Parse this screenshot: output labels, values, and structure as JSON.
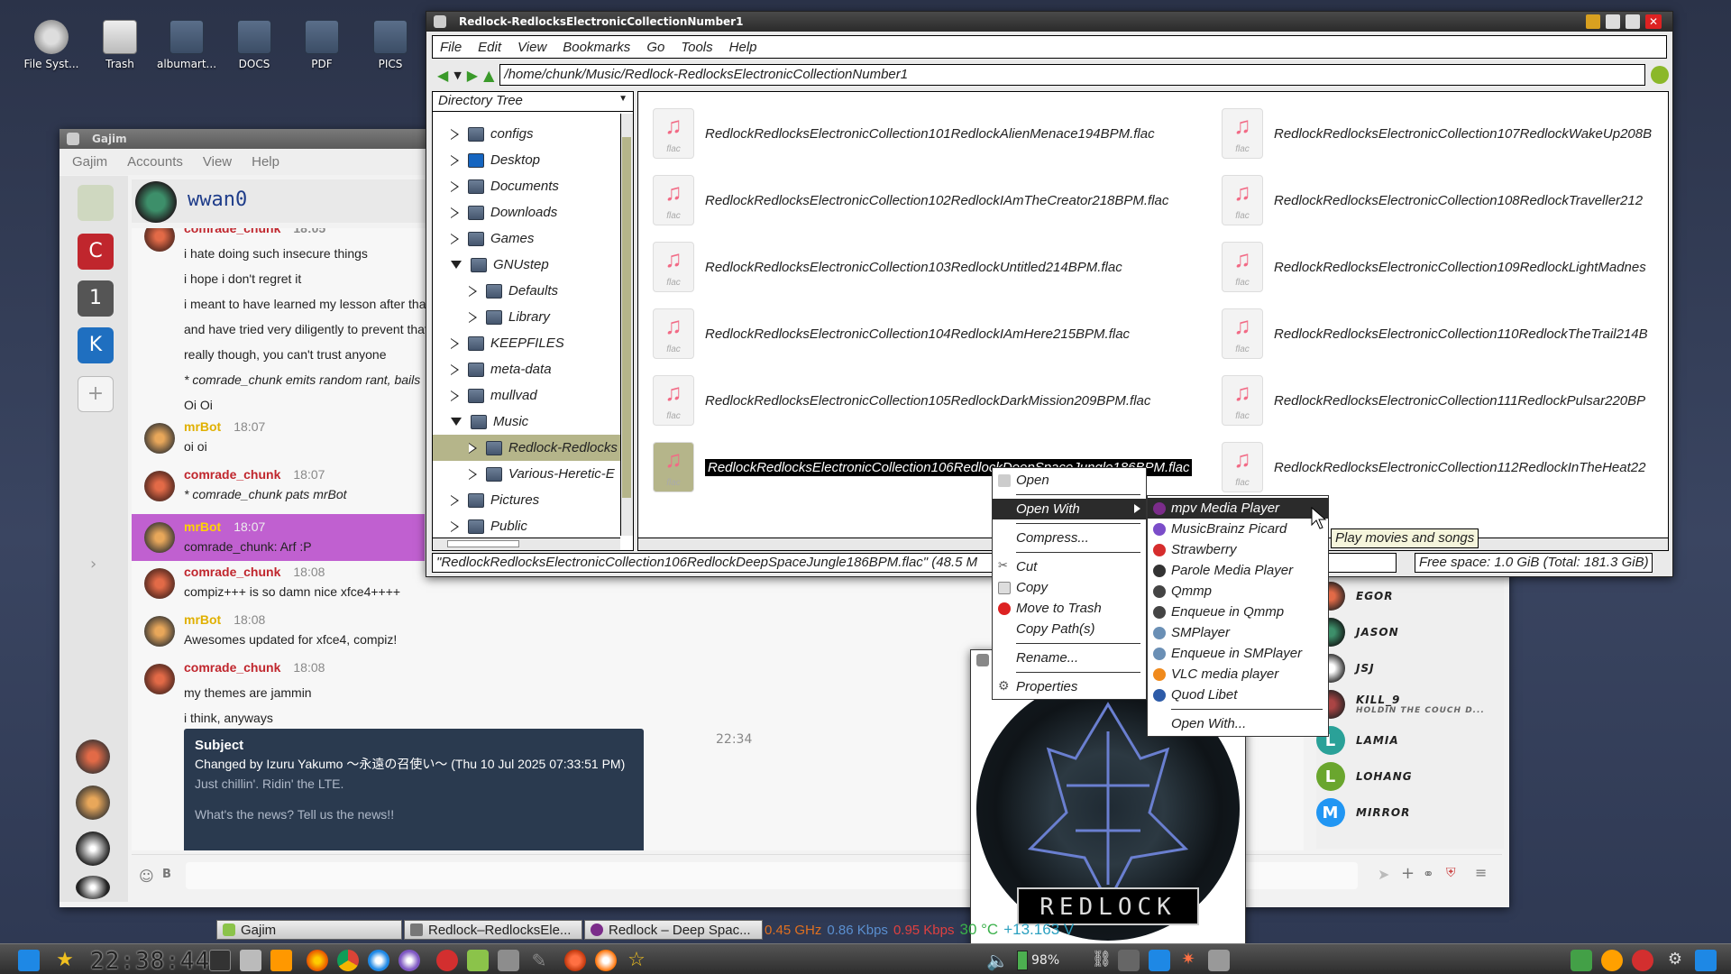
{
  "desktop": {
    "icons": [
      {
        "label": "File Syst..."
      },
      {
        "label": "Trash"
      },
      {
        "label": "albumart..."
      },
      {
        "label": "DOCS"
      },
      {
        "label": "PDF"
      },
      {
        "label": "PICS"
      }
    ]
  },
  "fm": {
    "title": "Redlock-RedlocksElectronicCollectionNumber1",
    "menu": [
      "File",
      "Edit",
      "View",
      "Bookmarks",
      "Go",
      "Tools",
      "Help"
    ],
    "location": "/home/chunk/Music/Redlock-RedlocksElectronicCollectionNumber1",
    "tree_header": "Directory Tree",
    "tree": [
      {
        "label": "configs",
        "level": 0,
        "state": "closed",
        "icon": "folder-icon"
      },
      {
        "label": "Desktop",
        "level": 0,
        "state": "closed",
        "icon": "desktop-folder-icon"
      },
      {
        "label": "Documents",
        "level": 0,
        "state": "closed",
        "icon": "folder-icon"
      },
      {
        "label": "Downloads",
        "level": 0,
        "state": "closed",
        "icon": "folder-icon"
      },
      {
        "label": "Games",
        "level": 0,
        "state": "closed",
        "icon": "folder-icon"
      },
      {
        "label": "GNUstep",
        "level": 0,
        "state": "open",
        "icon": "folder-icon"
      },
      {
        "label": "Defaults",
        "level": 1,
        "state": "closed",
        "icon": "folder-icon"
      },
      {
        "label": "Library",
        "level": 1,
        "state": "closed",
        "icon": "folder-icon"
      },
      {
        "label": "KEEPFILES",
        "level": 0,
        "state": "closed",
        "icon": "folder-icon"
      },
      {
        "label": "meta-data",
        "level": 0,
        "state": "closed",
        "icon": "folder-icon"
      },
      {
        "label": "mullvad",
        "level": 0,
        "state": "closed",
        "icon": "folder-icon"
      },
      {
        "label": "Music",
        "level": 0,
        "state": "open",
        "icon": "folder-icon"
      },
      {
        "label": "Redlock-Redlocks",
        "level": 1,
        "state": "closed",
        "icon": "folder-icon",
        "selected": true
      },
      {
        "label": "Various-Heretic-E",
        "level": 1,
        "state": "closed",
        "icon": "folder-icon"
      },
      {
        "label": "Pictures",
        "level": 0,
        "state": "closed",
        "icon": "folder-icon"
      },
      {
        "label": "Public",
        "level": 0,
        "state": "closed",
        "icon": "folder-icon"
      }
    ],
    "file_type_label": "flac",
    "files_left": [
      "RedlockRedlocksElectronicCollection101RedlockAlienMenace194BPM.flac",
      "RedlockRedlocksElectronicCollection102RedlockIAmTheCreator218BPM.flac",
      "RedlockRedlocksElectronicCollection103RedlockUntitled214BPM.flac",
      "RedlockRedlocksElectronicCollection104RedlockIAmHere215BPM.flac",
      "RedlockRedlocksElectronicCollection105RedlockDarkMission209BPM.flac",
      "RedlockRedlocksElectronicCollection106RedlockDeepSpaceJungle186BPM.flac"
    ],
    "files_right": [
      "RedlockRedlocksElectronicCollection107RedlockWakeUp208B",
      "RedlockRedlocksElectronicCollection108RedlockTraveller212",
      "RedlockRedlocksElectronicCollection109RedlockLightMadnes",
      "RedlockRedlocksElectronicCollection110RedlockTheTrail214B",
      "RedlockRedlocksElectronicCollection111RedlockPulsar220BP",
      "RedlockRedlocksElectronicCollection112RedlockInTheHeat22"
    ],
    "status": "\"RedlockRedlocksElectronicCollection106RedlockDeepSpaceJungle186BPM.flac\" (48.5 M",
    "free_space": "Free space: 1.0 GiB (Total: 181.3 GiB)",
    "tooltip": "Play movies and songs"
  },
  "context_menu": [
    {
      "label": "Open",
      "icon": "open-icon"
    },
    {
      "label": "Open With",
      "submenu": true,
      "highlighted": true
    },
    {
      "label": "Compress..."
    },
    {
      "label": "Cut",
      "icon": "scissors-icon"
    },
    {
      "label": "Copy",
      "icon": "copy-icon"
    },
    {
      "label": "Move to Trash",
      "icon": "trash-icon"
    },
    {
      "label": "Copy Path(s)"
    },
    {
      "label": "Rename..."
    },
    {
      "label": "Properties",
      "icon": "gear-icon"
    }
  ],
  "open_with": [
    {
      "label": "mpv Media Player",
      "icon": "mpv-icon",
      "color": "#7b2c8a",
      "highlighted": true
    },
    {
      "label": "MusicBrainz Picard",
      "icon": "picard-icon",
      "color": "#7b4dc9"
    },
    {
      "label": "Strawberry",
      "icon": "strawberry-icon",
      "color": "#d62d2d"
    },
    {
      "label": "Parole Media Player",
      "icon": "parole-icon",
      "color": "#333333"
    },
    {
      "label": "Qmmp",
      "icon": "qmmp-icon",
      "color": "#444444"
    },
    {
      "label": "Enqueue in Qmmp",
      "icon": "qmmp-icon",
      "color": "#444444"
    },
    {
      "label": "SMPlayer",
      "icon": "smplayer-icon",
      "color": "#6a8fb5"
    },
    {
      "label": "Enqueue in SMPlayer",
      "icon": "smplayer-icon",
      "color": "#6a8fb5"
    },
    {
      "label": "VLC media player",
      "icon": "vlc-icon",
      "color": "#f08a1c"
    },
    {
      "label": "Quod Libet",
      "icon": "quodlibet-icon",
      "color": "#2d5ba8"
    },
    {
      "label": "Open With..."
    }
  ],
  "gajim": {
    "title": "Gajim",
    "menu": [
      "Gajim",
      "Accounts",
      "View",
      "Help"
    ],
    "contact_name": "wwan0",
    "accounts": [
      {
        "label": "C",
        "color": "#c0262d"
      },
      {
        "label": "1",
        "color": "#555555"
      },
      {
        "label": "K",
        "color": "#1f6fc0"
      }
    ],
    "messages": [
      {
        "nick": "comrade_chunk",
        "time": "18:05",
        "lines": [
          "i hate doing such insecure things",
          "i hope i don't regret it",
          "i meant to have learned my lesson after that",
          "and have tried very diligently to prevent that",
          "really though, you can't trust anyone",
          "* comrade_chunk emits random rant, bails",
          "Oi Oi"
        ]
      },
      {
        "nick": "mrBot",
        "time": "18:07",
        "lines": [
          "oi oi"
        ]
      },
      {
        "nick": "comrade_chunk",
        "time": "18:07",
        "lines": [
          "* comrade_chunk pats mrBot"
        ]
      },
      {
        "nick": "mrBot",
        "time": "18:07",
        "lines": [
          "comrade_chunk: Arf :P"
        ]
      },
      {
        "nick": "comrade_chunk",
        "time": "18:08",
        "lines": [
          "compiz+++ is so damn nice xfce4++++"
        ]
      },
      {
        "nick": "mrBot",
        "time": "18:08",
        "lines": [
          "Awesomes updated for xfce4, compiz!"
        ]
      },
      {
        "nick": "comrade_chunk",
        "time": "18:08",
        "lines": [
          "my themes are jammin",
          "i think, anyways"
        ]
      }
    ],
    "subject": {
      "title": "Subject",
      "changed_by": "Changed by Izuru Yakumo 〜永遠の召使い〜 (Thu 10 Jul 2025 07:33:51 PM)",
      "line1": "Just chillin'.  Ridin' the LTE.",
      "line2": "What's the news?  Tell us the news!!",
      "time": "22:34"
    },
    "roster": [
      "EGOR",
      "JASON",
      "JSJ",
      "KILL_9",
      "LAMIA",
      "LOHANG",
      "MIRROR"
    ],
    "kill9_status": "HOLDIN THE COUCH D...",
    "roster_avatars": {
      "LAMIA": "L",
      "LOHANG": "L",
      "MIRROR": "M"
    }
  },
  "album": {
    "text": "REDLOCK"
  },
  "tasks": [
    {
      "label": "Gajim"
    },
    {
      "label": "Redlock–RedlocksEle..."
    },
    {
      "label": "Redlock – Deep Spac..."
    }
  ],
  "sysmon": {
    "cpu": "0.45 GHz",
    "down": "0.86 Kbps",
    "up": "0.95 Kbps",
    "temp": "30 °C",
    "volt": "+13.163 V"
  },
  "clock": "22:38:44",
  "battery": "98%",
  "colors": {
    "selection": "#c060d0",
    "mrbot": "#e0b000",
    "chunk": "#c0262d"
  }
}
